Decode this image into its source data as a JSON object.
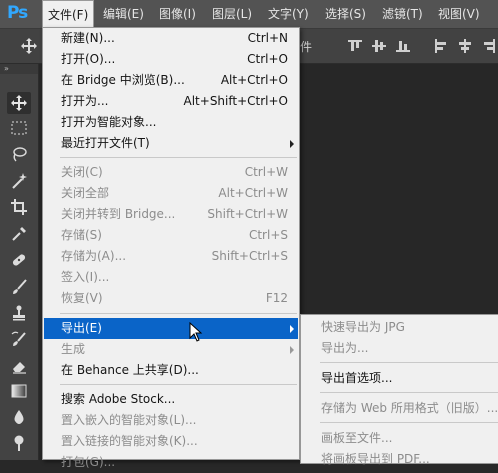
{
  "app": {
    "logo": "Ps"
  },
  "menubar": {
    "items": [
      {
        "label": "文件(F)",
        "active": true
      },
      {
        "label": "编辑(E)"
      },
      {
        "label": "图像(I)"
      },
      {
        "label": "图层(L)"
      },
      {
        "label": "文字(Y)"
      },
      {
        "label": "选择(S)"
      },
      {
        "label": "滤镜(T)"
      },
      {
        "label": "视图(V)"
      }
    ]
  },
  "options_bar": {
    "partial_text": "件"
  },
  "tools": [
    "move-tool-icon",
    "rectangular-marquee-icon",
    "lasso-icon",
    "magic-wand-icon",
    "crop-icon",
    "eyedropper-icon",
    "healing-brush-icon",
    "brush-icon",
    "clone-stamp-icon",
    "history-brush-icon",
    "eraser-icon",
    "gradient-icon",
    "blur-icon",
    "dodge-icon"
  ],
  "file_menu": {
    "items": [
      {
        "label": "新建(N)...",
        "shortcut": "Ctrl+N"
      },
      {
        "label": "打开(O)...",
        "shortcut": "Ctrl+O"
      },
      {
        "label": "在 Bridge 中浏览(B)...",
        "shortcut": "Alt+Ctrl+O"
      },
      {
        "label": "打开为...",
        "shortcut": "Alt+Shift+Ctrl+O"
      },
      {
        "label": "打开为智能对象..."
      },
      {
        "label": "最近打开文件(T)",
        "submenu": true
      },
      {
        "label": "关闭(C)",
        "shortcut": "Ctrl+W",
        "disabled": true
      },
      {
        "label": "关闭全部",
        "shortcut": "Alt+Ctrl+W",
        "disabled": true
      },
      {
        "label": "关闭并转到 Bridge...",
        "shortcut": "Shift+Ctrl+W",
        "disabled": true
      },
      {
        "label": "存储(S)",
        "shortcut": "Ctrl+S",
        "disabled": true
      },
      {
        "label": "存储为(A)...",
        "shortcut": "Shift+Ctrl+S",
        "disabled": true
      },
      {
        "label": "签入(I)...",
        "disabled": true
      },
      {
        "label": "恢复(V)",
        "shortcut": "F12",
        "disabled": true
      },
      {
        "label": "导出(E)",
        "submenu": true,
        "highlighted": true
      },
      {
        "label": "生成",
        "submenu": true,
        "disabled": true
      },
      {
        "label": "在 Behance 上共享(D)..."
      },
      {
        "label": "搜索 Adobe Stock..."
      },
      {
        "label": "置入嵌入的智能对象(L)...",
        "disabled": true
      },
      {
        "label": "置入链接的智能对象(K)...",
        "disabled": true
      },
      {
        "label": "打包(G)...",
        "disabled": true
      }
    ]
  },
  "export_submenu": {
    "items": [
      {
        "label": "快速导出为 JPG",
        "disabled": true
      },
      {
        "label": "导出为...",
        "disabled": true
      },
      {
        "label": "导出首选项..."
      },
      {
        "label": "存储为 Web 所用格式（旧版）...",
        "disabled": true
      },
      {
        "label": "画板至文件...",
        "disabled": true
      },
      {
        "label": "将画板导出到 PDF...",
        "disabled": true
      }
    ]
  }
}
